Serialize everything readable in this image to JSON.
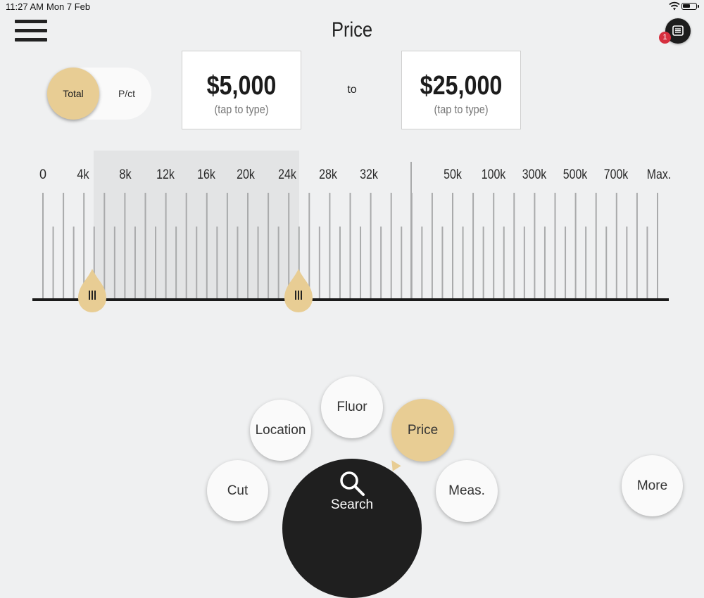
{
  "status_bar": {
    "time": "11:27 AM",
    "date": "Mon 7 Feb"
  },
  "header": {
    "title": "Price",
    "badge_count": "1"
  },
  "toggle": {
    "total_label": "Total",
    "per_ct_label": "P/ct",
    "selected": "Total"
  },
  "price_range": {
    "min": {
      "value": "$5,000",
      "hint": "(tap to type)"
    },
    "separator": "to",
    "max": {
      "value": "$25,000",
      "hint": "(tap to type)"
    }
  },
  "scale": {
    "labels": [
      "0",
      "4k",
      "8k",
      "12k",
      "16k",
      "20k",
      "24k",
      "28k",
      "32k",
      "50k",
      "100k",
      "300k",
      "500k",
      "700k",
      "Max."
    ],
    "handle_min": "5k",
    "handle_max": "25k"
  },
  "filters": [
    {
      "label": "Cut",
      "active": false
    },
    {
      "label": "Location",
      "active": false
    },
    {
      "label": "Fluor",
      "active": false
    },
    {
      "label": "Price",
      "active": true
    },
    {
      "label": "Meas.",
      "active": false
    }
  ],
  "search_label": "Search",
  "more_label": "More",
  "colors": {
    "accent": "#e8cd94",
    "dark": "#1f1f1f",
    "badge": "#d6303f",
    "background": "#eff0f1"
  }
}
